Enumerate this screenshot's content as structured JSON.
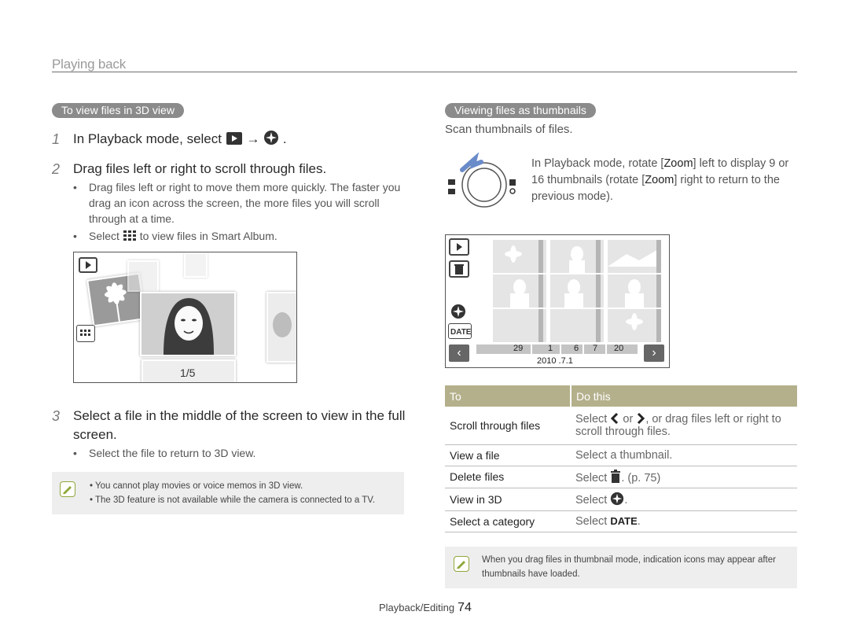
{
  "header": {
    "section_title": "Playing back"
  },
  "left": {
    "pill": "To view files in 3D view",
    "step1": {
      "num": "1",
      "pre": "In Playback mode, select",
      "arrow": "→",
      "post": "."
    },
    "step2": {
      "num": "2",
      "text": "Drag files left or right to scroll through files."
    },
    "bullets2": [
      "Drag files left or right to move them more quickly. The faster you drag an icon across the screen, the more files you will scroll through at a time.",
      {
        "pre": "Select",
        "post": "to view files in Smart Album."
      }
    ],
    "counter": "1/5",
    "step3": {
      "num": "3",
      "line1": "Select a file in the middle of the screen to view in the full",
      "line2": "screen."
    },
    "bullet3": "Select the file to return to 3D view.",
    "note": [
      "You cannot play movies or voice memos in 3D view.",
      "The 3D feature is not available while the camera is connected to a TV."
    ]
  },
  "right": {
    "pill": "Viewing files as thumbnails",
    "scan": "Scan thumbnails of files.",
    "zoom_text": {
      "a": "In Playback mode, rotate [",
      "zoom1": "Zoom",
      "b": "] left to display 9 or 16 thumbnails (rotate [",
      "zoom2": "Zoom",
      "c": "] right to return to the previous mode)."
    },
    "timeline": {
      "nums": [
        "29",
        "1",
        "6",
        "7",
        "20"
      ],
      "date": "2010 .7.1"
    },
    "table": {
      "headers": [
        "To",
        "Do this"
      ],
      "rows": [
        {
          "to": "Scroll through files",
          "do_a": "Select",
          "do_b": "or",
          "do_c": ", or drag files left or right to scroll through files."
        },
        {
          "to": "View a file",
          "do": "Select a thumbnail."
        },
        {
          "to": "Delete files",
          "do_a": "Select",
          "do_b": ". (p. 75)"
        },
        {
          "to": "View in 3D",
          "do_a": "Select",
          "do_b": "."
        },
        {
          "to": "Select a category",
          "do_a": "Select",
          "do_b": "DATE",
          "do_c": "."
        }
      ]
    },
    "note": "When you drag files in thumbnail mode, indication icons may appear after thumbnails have loaded."
  },
  "footer": {
    "label": "Playback/Editing",
    "page": "74"
  }
}
